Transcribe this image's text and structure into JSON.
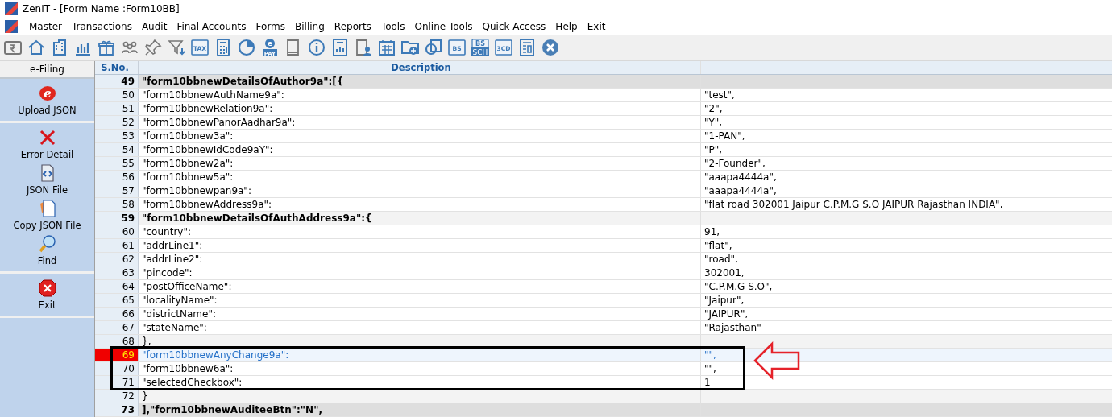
{
  "window": {
    "title": "ZenIT - [Form Name :Form10BB]"
  },
  "menu": [
    "Master",
    "Transactions",
    "Audit",
    "Final Accounts",
    "Forms",
    "Billing",
    "Reports",
    "Tools",
    "Online Tools",
    "Quick Access",
    "Help",
    "Exit"
  ],
  "toolbar": [
    {
      "kind": "rupee"
    },
    {
      "kind": "home"
    },
    {
      "kind": "building"
    },
    {
      "kind": "bars"
    },
    {
      "kind": "gift"
    },
    {
      "kind": "people"
    },
    {
      "kind": "pin"
    },
    {
      "kind": "filter"
    },
    {
      "kind": "text",
      "label": "TAX"
    },
    {
      "kind": "calculator"
    },
    {
      "kind": "pie"
    },
    {
      "kind": "epay",
      "mark": "e",
      "label": "PAY"
    },
    {
      "kind": "book"
    },
    {
      "kind": "info"
    },
    {
      "kind": "report"
    },
    {
      "kind": "user"
    },
    {
      "kind": "calendar"
    },
    {
      "kind": "folder"
    },
    {
      "kind": "circle"
    },
    {
      "kind": "text",
      "label": "BS"
    },
    {
      "kind": "text2",
      "label": "BS",
      "sub": "SCH"
    },
    {
      "kind": "text",
      "label": "3CD"
    },
    {
      "kind": "sheet"
    },
    {
      "kind": "close"
    }
  ],
  "sidebar": {
    "title": "e-Filing",
    "sections": [
      [
        {
          "kind": "upload",
          "mark": "e",
          "label": "Upload JSON"
        }
      ],
      [
        {
          "kind": "error",
          "label": "Error Detail"
        },
        {
          "kind": "json",
          "label": "JSON File"
        },
        {
          "kind": "copy",
          "label": "Copy JSON File"
        },
        {
          "kind": "find",
          "label": "Find"
        }
      ],
      [
        {
          "kind": "exit",
          "label": "Exit"
        }
      ]
    ]
  },
  "table": {
    "columns": [
      "S.No.",
      "Description"
    ],
    "rows": [
      {
        "sno": "49",
        "key": "\"form10bbnewDetailsOfAuthor9a\":[{",
        "value": "",
        "kind": "group",
        "selected": false
      },
      {
        "sno": "50",
        "key": "\"form10bbnewAuthName9a\":",
        "value": "\"test\",",
        "kind": "field",
        "selected": false
      },
      {
        "sno": "51",
        "key": "\"form10bbnewRelation9a\":",
        "value": "\"2\",",
        "kind": "field",
        "selected": false
      },
      {
        "sno": "52",
        "key": "\"form10bbnewPanorAadhar9a\":",
        "value": "\"Y\",",
        "kind": "field",
        "selected": false
      },
      {
        "sno": "53",
        "key": "\"form10bbnew3a\":",
        "value": "\"1-PAN\",",
        "kind": "field",
        "selected": false
      },
      {
        "sno": "54",
        "key": "\"form10bbnewIdCode9aY\":",
        "value": "\"P\",",
        "kind": "field",
        "selected": false
      },
      {
        "sno": "55",
        "key": "\"form10bbnew2a\":",
        "value": "\"2-Founder\",",
        "kind": "field",
        "selected": false
      },
      {
        "sno": "56",
        "key": "\"form10bbnew5a\":",
        "value": "\"aaapa4444a\",",
        "kind": "field",
        "selected": false
      },
      {
        "sno": "57",
        "key": "\"form10bbnewpan9a\":",
        "value": "\"aaapa4444a\",",
        "kind": "field",
        "selected": false
      },
      {
        "sno": "58",
        "key": "\"form10bbnewAddress9a\":",
        "value": "\"flat road 302001 Jaipur C.P.M.G S.O JAIPUR Rajasthan INDIA\",",
        "kind": "field",
        "selected": false
      },
      {
        "sno": "59",
        "key": "\"form10bbnewDetailsOfAuthAddress9a\":{",
        "value": "",
        "kind": "subgroup",
        "selected": false
      },
      {
        "sno": "60",
        "key": "\"country\":",
        "value": "91,",
        "kind": "field",
        "selected": false
      },
      {
        "sno": "61",
        "key": "\"addrLine1\":",
        "value": "\"flat\",",
        "kind": "field",
        "selected": false
      },
      {
        "sno": "62",
        "key": "\"addrLine2\":",
        "value": "\"road\",",
        "kind": "field",
        "selected": false
      },
      {
        "sno": "63",
        "key": "\"pincode\":",
        "value": "302001,",
        "kind": "field",
        "selected": false
      },
      {
        "sno": "64",
        "key": "\"postOfficeName\":",
        "value": "\"C.P.M.G S.O\",",
        "kind": "field",
        "selected": false
      },
      {
        "sno": "65",
        "key": "\"localityName\":",
        "value": "\"Jaipur\",",
        "kind": "field",
        "selected": false
      },
      {
        "sno": "66",
        "key": "\"districtName\":",
        "value": "\"JAIPUR\",",
        "kind": "field",
        "selected": false
      },
      {
        "sno": "67",
        "key": "\"stateName\":",
        "value": "\"Rajasthan\"",
        "kind": "field",
        "selected": false
      },
      {
        "sno": "68",
        "key": "},",
        "value": "",
        "kind": "close",
        "selected": false
      },
      {
        "sno": "69",
        "key": "\"form10bbnewAnyChange9a\":",
        "value": "\"\",",
        "kind": "field",
        "selected": true
      },
      {
        "sno": "70",
        "key": "\"form10bbnew6a\":",
        "value": "\"\",",
        "kind": "field",
        "selected": false
      },
      {
        "sno": "71",
        "key": "\"selectedCheckbox\":",
        "value": "1",
        "kind": "field",
        "selected": false
      },
      {
        "sno": "72",
        "key": "}",
        "value": "",
        "kind": "close",
        "selected": false
      },
      {
        "sno": "73",
        "key": "],\"form10bbnewAuditeeBtn\":\"N\",",
        "value": "",
        "kind": "group",
        "selected": false
      }
    ]
  }
}
